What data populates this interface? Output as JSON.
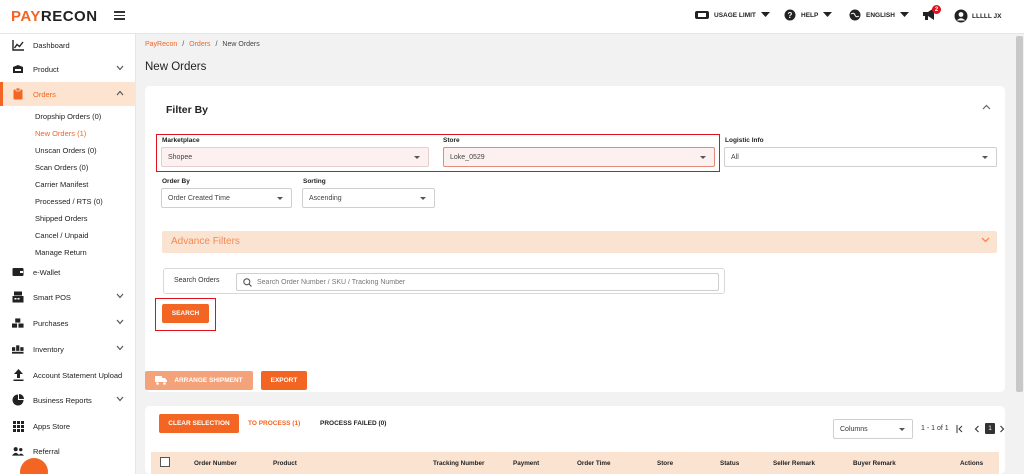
{
  "brand": {
    "pay": "PAY",
    "recon": "RECON",
    "accent": "#f26522"
  },
  "topnav": {
    "usage_limit": "USAGE LIMIT",
    "help": "HELP",
    "language": "ENGLISH",
    "notifications_count": "2",
    "user": "LLLLL JX"
  },
  "sidebar": {
    "dashboard": "Dashboard",
    "product": "Product",
    "orders": "Orders",
    "orders_sub": [
      "Dropship Orders (0)",
      "New Orders (1)",
      "Unscan Orders (0)",
      "Scan Orders (0)",
      "Carrier Manifest",
      "Processed / RTS (0)",
      "Shipped Orders",
      "Cancel / Unpaid",
      "Manage Return"
    ],
    "ewallet": "e-Wallet",
    "smart_pos": "Smart POS",
    "purchases": "Purchases",
    "inventory": "Inventory",
    "account_statement": "Account Statement Upload",
    "business_reports": "Business Reports",
    "apps_store": "Apps Store",
    "referral": "Referral"
  },
  "breadcrumb": {
    "root": "PayRecon",
    "orders": "Orders",
    "current": "New Orders",
    "sep": "/"
  },
  "page_title": "New Orders",
  "filter": {
    "title": "Filter By",
    "marketplace_label": "Marketplace",
    "marketplace_value": "Shopee",
    "store_label": "Store",
    "store_value": "Loke_0529",
    "logistic_label": "Logistic Info",
    "logistic_value": "All",
    "order_by_label": "Order By",
    "order_by_value": "Order Created Time",
    "sorting_label": "Sorting",
    "sorting_value": "Ascending",
    "advance_filters": "Advance Filters",
    "search_label": "Search Orders",
    "search_placeholder": "Search Order Number / SKU / Tracking Number",
    "search_button": "SEARCH"
  },
  "actions": {
    "arrange_shipment": "ARRANGE SHIPMENT",
    "export": "EXPORT"
  },
  "table": {
    "clear_selection": "CLEAR SELECTION",
    "tab_to_process": "TO PROCESS (1)",
    "tab_process_failed": "PROCESS FAILED (0)",
    "columns": "Columns",
    "pagination": "1 - 1 of 1",
    "current_page": "1",
    "headers": [
      "Order Number",
      "Product",
      "Tracking Number",
      "Payment",
      "Order Time",
      "Store",
      "Status",
      "Seller Remark",
      "Buyer Remark",
      "Actions"
    ]
  }
}
